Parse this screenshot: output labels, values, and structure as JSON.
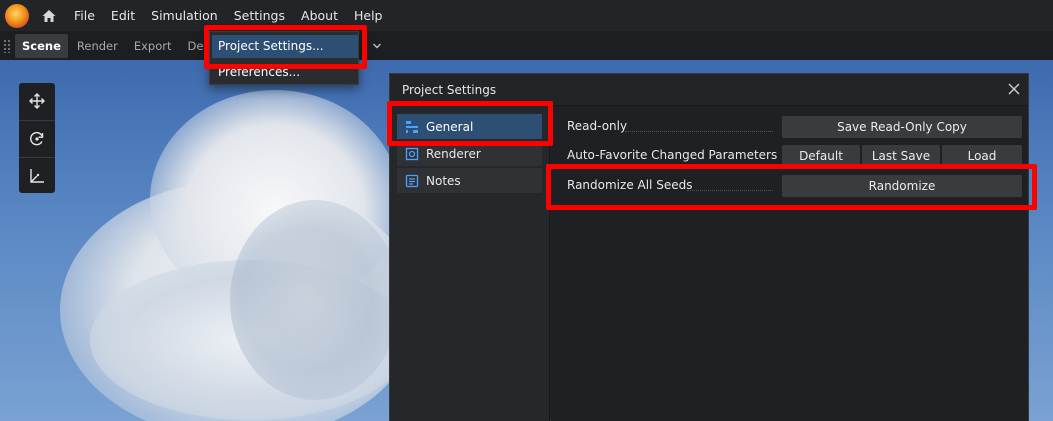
{
  "menubar": {
    "items": [
      "File",
      "Edit",
      "Simulation",
      "Settings",
      "About",
      "Help"
    ]
  },
  "tabs": [
    "Scene",
    "Render",
    "Export",
    "Debug"
  ],
  "dropdown": {
    "items": [
      "Project Settings...",
      "Preferences..."
    ]
  },
  "window": {
    "title": "Project Settings",
    "sidebar": [
      "General",
      "Renderer",
      "Notes"
    ],
    "rows": {
      "readonly": {
        "label": "Read-only",
        "button": "Save Read-Only Copy"
      },
      "autofav": {
        "label": "Auto-Favorite Changed Parameters",
        "buttons": [
          "Default",
          "Last Save",
          "Load"
        ]
      },
      "randomize": {
        "label": "Randomize All Seeds",
        "button": "Randomize"
      }
    }
  },
  "colors": {
    "accent": "#2e4f74",
    "highlight": "#ff0000"
  },
  "icons": {
    "logo": "app-logo-icon",
    "home": "home-icon",
    "tools": [
      "move-icon",
      "rotate-icon",
      "axes-icon"
    ],
    "sidebar": [
      "general-icon",
      "renderer-icon",
      "notes-icon"
    ],
    "close": "close-icon",
    "tab_overflow": "chevron-down-icon"
  }
}
